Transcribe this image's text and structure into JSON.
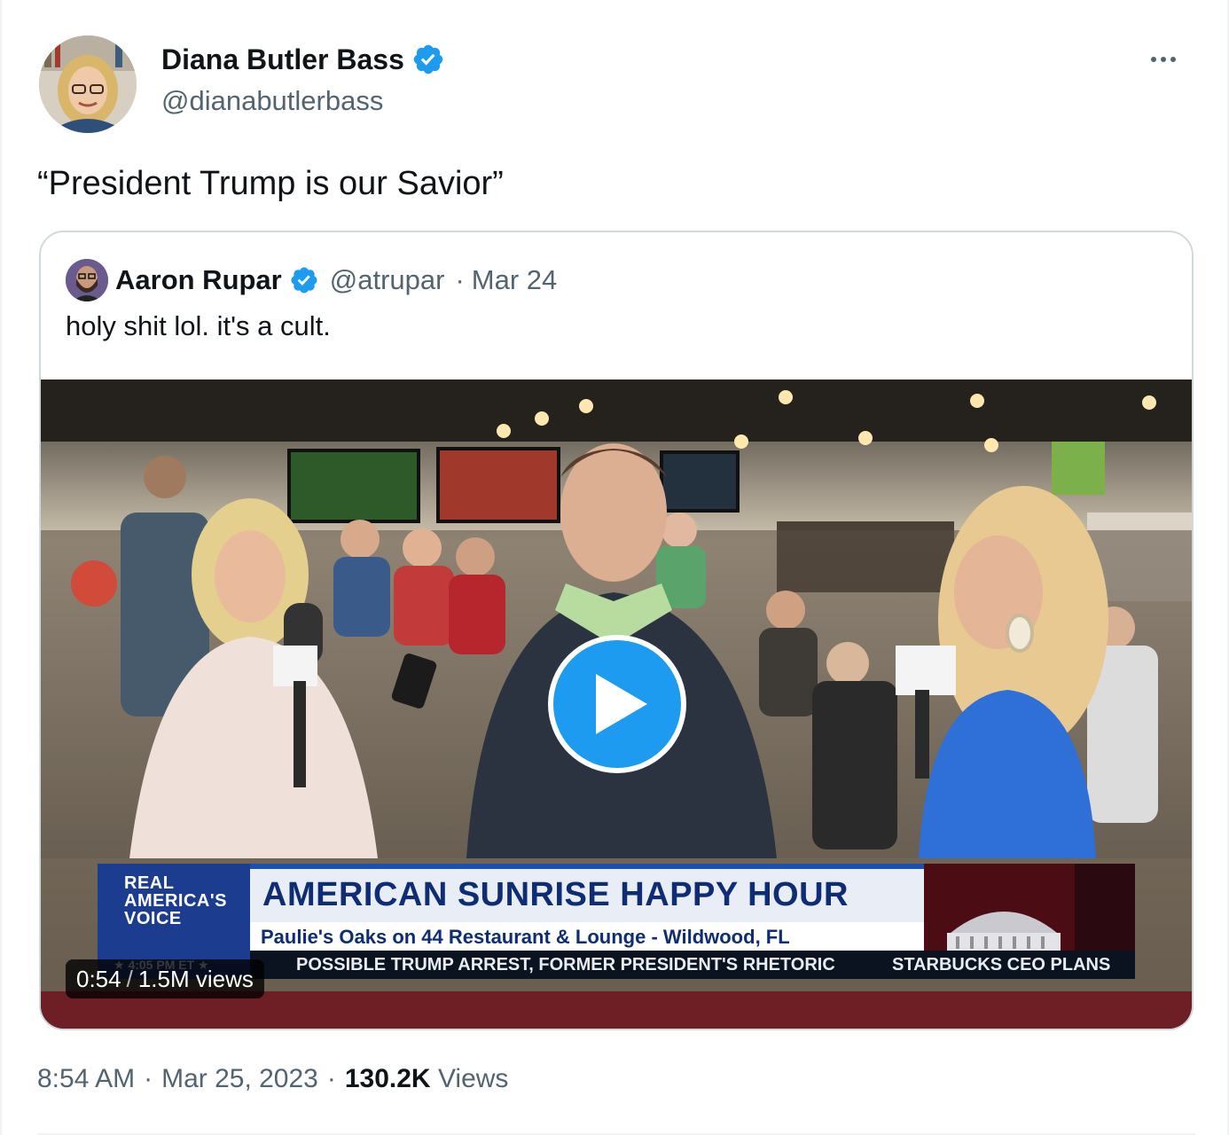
{
  "author": {
    "display_name": "Diana Butler Bass",
    "handle": "@dianabutlerbass",
    "verified_icon": "verified-badge-icon"
  },
  "tweet": {
    "text": "“President Trump is our Savior”"
  },
  "quoted_tweet": {
    "display_name": "Aaron Rupar",
    "handle": "@atrupar",
    "separator": "·",
    "date": "Mar 24",
    "text": "holy shit lol. it's a cult.",
    "video": {
      "duration": "0:54",
      "divider": "/",
      "views": "1.5M views",
      "lower_third": {
        "network": [
          "REAL",
          "AMERICA'S",
          "VOICE"
        ],
        "time": "★ 4:05 PM ET ★",
        "title": "AMERICAN SUNRISE HAPPY HOUR",
        "subtitle": "Paulie's Oaks on 44 Restaurant &  Lounge - Wildwood, FL",
        "ticker_1": "POSSIBLE TRUMP ARREST, FORMER PRESIDENT'S RHETORIC",
        "ticker_2": "STARBUCKS CEO PLANS"
      }
    }
  },
  "meta": {
    "time": "8:54 AM",
    "dot1": "·",
    "date": "Mar 25, 2023",
    "dot2": "·",
    "view_count": "130.2K",
    "view_label": "Views"
  },
  "colors": {
    "accent": "#1d9bf0",
    "secondary_text": "#536471",
    "primary_text": "#0f1419",
    "border": "#cfd9de"
  }
}
